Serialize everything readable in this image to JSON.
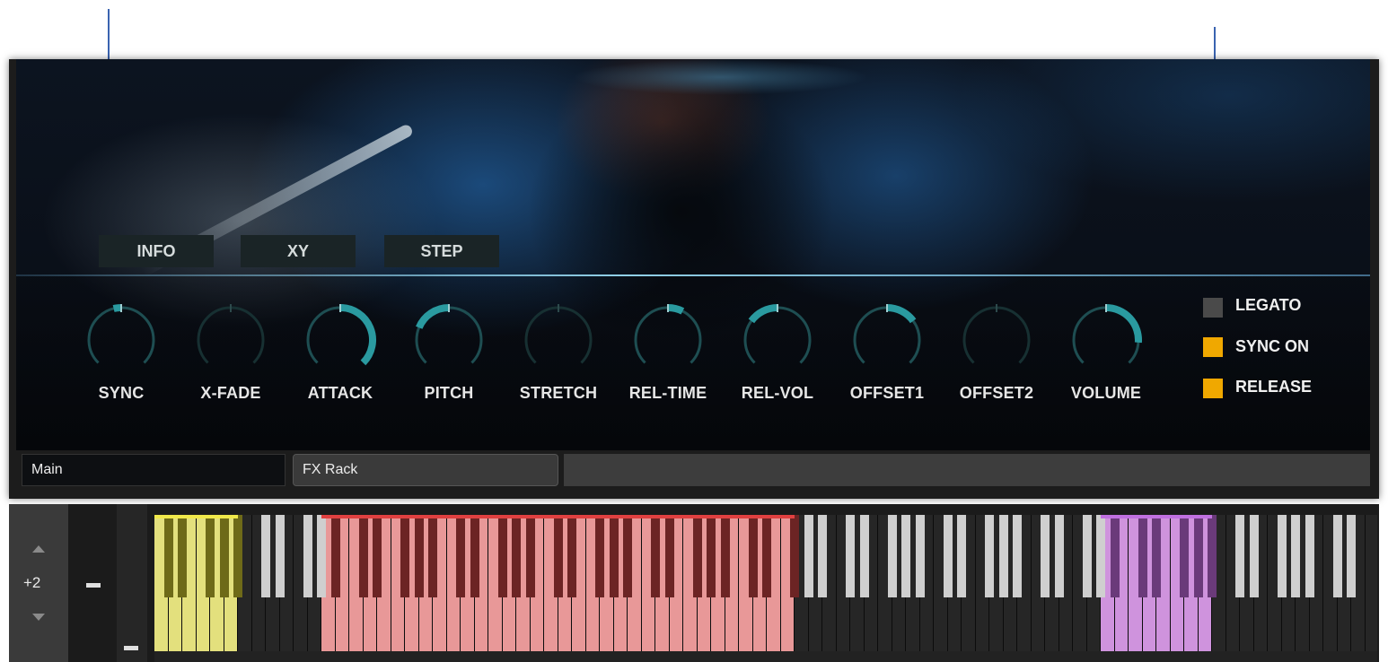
{
  "tabs": [
    {
      "label": "INFO"
    },
    {
      "label": "XY"
    },
    {
      "label": "STEP"
    }
  ],
  "knobs": [
    {
      "label": "SYNC",
      "value": 0.45,
      "active": true
    },
    {
      "label": "X-FADE",
      "value": 0.0,
      "active": false
    },
    {
      "label": "ATTACK",
      "value": 1.0,
      "active": true
    },
    {
      "label": "PITCH",
      "value": 0.25,
      "active": true
    },
    {
      "label": "STRETCH",
      "value": 0.0,
      "active": false
    },
    {
      "label": "REL-TIME",
      "value": 0.6,
      "active": true
    },
    {
      "label": "REL-VOL",
      "value": 0.3,
      "active": true
    },
    {
      "label": "OFFSET1",
      "value": 0.7,
      "active": true
    },
    {
      "label": "OFFSET2",
      "value": 0.0,
      "active": false
    },
    {
      "label": "VOLUME",
      "value": 0.85,
      "active": true
    }
  ],
  "options": [
    {
      "label": "LEGATO",
      "checked": false
    },
    {
      "label": "SYNC ON",
      "checked": true
    },
    {
      "label": "RELEASE",
      "checked": true
    }
  ],
  "subtabs": [
    {
      "label": "Main"
    },
    {
      "label": "FX Rack"
    }
  ],
  "octave_display": "+2",
  "colors": {
    "accent": "#2a9aa0",
    "checkbox_on": "#f0a800",
    "checkbox_off": "#4a4a4a",
    "zone_yellow": "#e3e07d",
    "zone_red": "#e89898",
    "zone_purple": "#cf93dd"
  }
}
